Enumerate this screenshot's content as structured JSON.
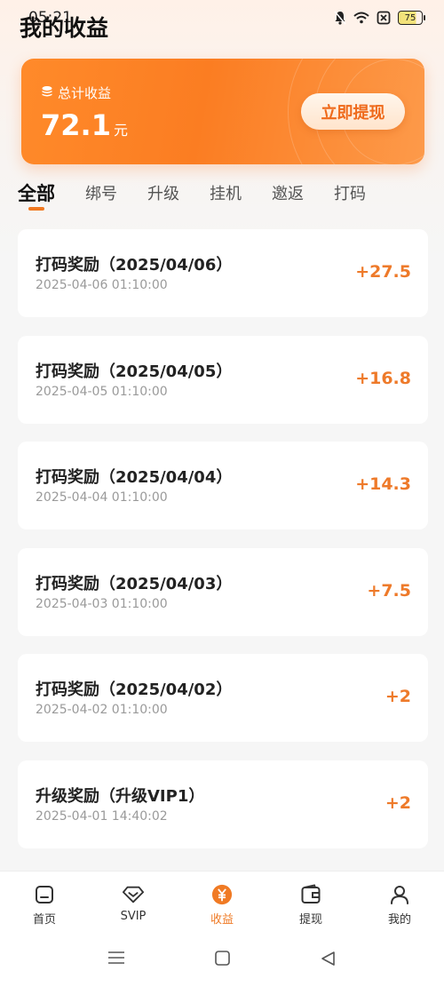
{
  "status_bar": {
    "time": "05:21",
    "battery": "75"
  },
  "header": {
    "title": "我的收益"
  },
  "summary": {
    "label": "总计收益",
    "amount": "72.1",
    "unit": "元",
    "withdraw_label": "立即提现"
  },
  "tabs": [
    {
      "label": "全部",
      "active": true
    },
    {
      "label": "绑号"
    },
    {
      "label": "升级"
    },
    {
      "label": "挂机"
    },
    {
      "label": "邀返"
    },
    {
      "label": "打码"
    }
  ],
  "records": [
    {
      "title": "打码奖励（2025/04/06）",
      "time": "2025-04-06 01:10:00",
      "amount": "+27.5"
    },
    {
      "title": "打码奖励（2025/04/05）",
      "time": "2025-04-05 01:10:00",
      "amount": "+16.8"
    },
    {
      "title": "打码奖励（2025/04/04）",
      "time": "2025-04-04 01:10:00",
      "amount": "+14.3"
    },
    {
      "title": "打码奖励（2025/04/03）",
      "time": "2025-04-03 01:10:00",
      "amount": "+7.5"
    },
    {
      "title": "打码奖励（2025/04/02）",
      "time": "2025-04-02 01:10:00",
      "amount": "+2"
    },
    {
      "title": "升级奖励（升级VIP1）",
      "time": "2025-04-01 14:40:02",
      "amount": "+2"
    }
  ],
  "tabbar": [
    {
      "label": "首页",
      "icon": "home-icon"
    },
    {
      "label": "SVIP",
      "icon": "diamond-icon"
    },
    {
      "label": "收益",
      "icon": "yen-icon",
      "active": true
    },
    {
      "label": "提现",
      "icon": "wallet-icon"
    },
    {
      "label": "我的",
      "icon": "user-icon"
    }
  ],
  "colors": {
    "accent": "#ef7a25",
    "amount": "#ee7a2a",
    "card_gradient_start": "#ff8a2a"
  }
}
